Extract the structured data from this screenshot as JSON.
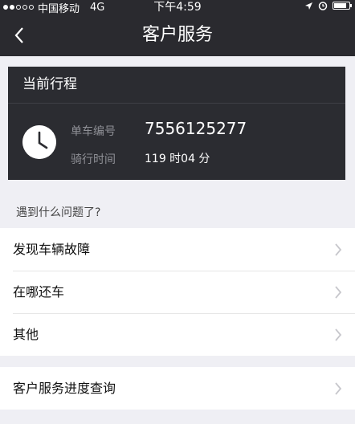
{
  "status_bar": {
    "carrier": "中国移动",
    "network": "4G",
    "time": "下午4:59"
  },
  "nav": {
    "back_icon": "chevron-left-icon",
    "title": "客户服务"
  },
  "trip": {
    "header": "当前行程",
    "bike_label": "单车编号",
    "bike_number": "7556125277",
    "time_label": "骑行时间",
    "duration": "119 时04 分"
  },
  "problems": {
    "hint": "遇到什么问题了?",
    "items": [
      "发现车辆故障",
      "在哪还车",
      "其他"
    ]
  },
  "progress": {
    "label": "客户服务进度查询"
  },
  "colors": {
    "bar_bg": "#2a2a2f",
    "card_bg": "#2b2c31",
    "page_bg": "#efeff4",
    "label_gray": "#8f9096"
  }
}
